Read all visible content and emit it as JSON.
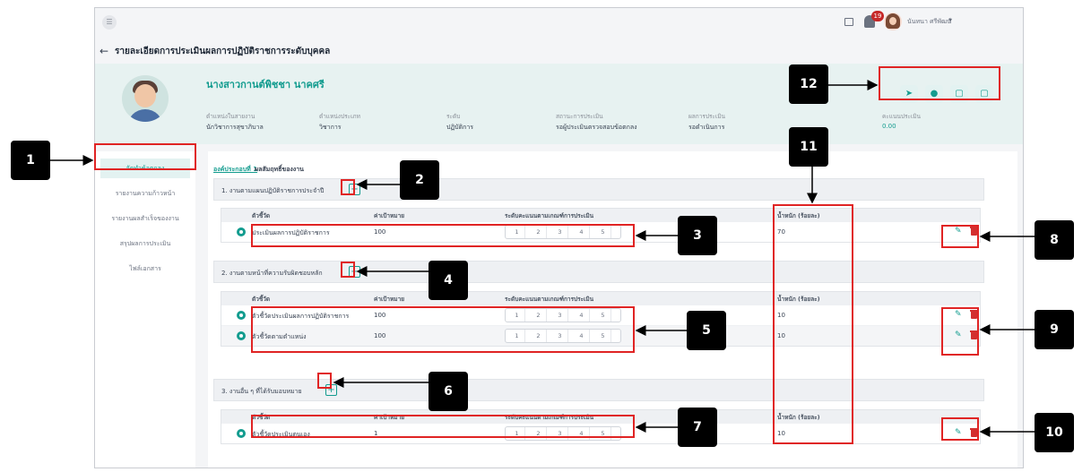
{
  "topbar": {
    "menu_icon": "menu-icon",
    "notification_count": "19",
    "user_name": "นันทนา ศรีพัฒน์"
  },
  "page": {
    "title": "รายละเอียดการประเมินผลการปฏิบัติราชการระดับบุคคล"
  },
  "profile": {
    "name": "นางสาวกานต์พิชชา นาคศรี",
    "fields": [
      {
        "label": "ตำแหน่งในสายงาน",
        "value": "นักวิชาการสุขาภิบาล"
      },
      {
        "label": "ตำแหน่งประเภท",
        "value": "วิชาการ"
      },
      {
        "label": "ระดับ",
        "value": "ปฏิบัติการ"
      },
      {
        "label": "สถานะการประเมิน",
        "value": "รอผู้ประเมินตรวจสอบข้อตกลง"
      },
      {
        "label": "ผลการประเมิน",
        "value": "รอดำเนินการ"
      },
      {
        "label": "คะแนนประเมิน",
        "value": "0.00"
      }
    ]
  },
  "sidebar": {
    "items": [
      {
        "label": "จัดทำข้อตกลง"
      },
      {
        "label": "รายงานความก้าวหน้า"
      },
      {
        "label": "รายงานผลสำเร็จของงาน"
      },
      {
        "label": "สรุปผลการประเมิน"
      },
      {
        "label": "ไฟล์เอกสาร"
      }
    ]
  },
  "content": {
    "component_link": "องค์ประกอบที่ 1",
    "component_title": "ผลสัมฤทธิ์ของงาน",
    "headers": {
      "indicator": "ตัวชี้วัด",
      "target": "ค่าเป้าหมาย",
      "scale": "ระดับคะแนนตามเกณฑ์การประเมิน",
      "weight": "น้ำหนัก (ร้อยละ)"
    },
    "levels": [
      "1",
      "2",
      "3",
      "4",
      "5"
    ],
    "sections": [
      {
        "title": "1. งานตามแผนปฏิบัติราชการประจำปี",
        "rows": [
          {
            "indicator": "ประเมินผลการปฏิบัติราชการ",
            "target": "100",
            "weight": "70"
          }
        ]
      },
      {
        "title": "2. งานตามหน้าที่ความรับผิดชอบหลัก",
        "rows": [
          {
            "indicator": "ตัวชี้วัดประเมินผลการปฏิบัติราชการ",
            "target": "100",
            "weight": "10"
          },
          {
            "indicator": "ตัวชี้วัดตามตำแหน่ง",
            "target": "100",
            "weight": "10"
          }
        ]
      },
      {
        "title": "3. งานอื่น ๆ ที่ได้รับมอบหมาย",
        "rows": [
          {
            "indicator": "ตัวชี้วัดประเมินตนเอง",
            "target": "1",
            "weight": "10"
          }
        ]
      }
    ]
  },
  "callouts": [
    "1",
    "2",
    "3",
    "4",
    "5",
    "6",
    "7",
    "8",
    "9",
    "10",
    "11",
    "12"
  ],
  "colors": {
    "accent": "#139c8f",
    "danger": "#d32f2f",
    "annotation": "#e02424"
  }
}
